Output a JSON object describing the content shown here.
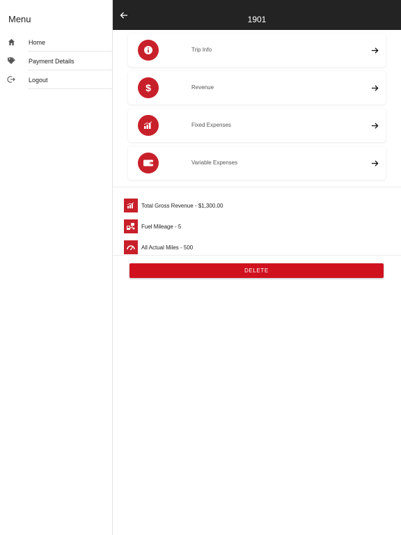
{
  "sidebar": {
    "title": "Menu",
    "items": [
      {
        "label": "Home",
        "icon": "home-icon"
      },
      {
        "label": "Payment Details",
        "icon": "tag-icon"
      },
      {
        "label": "Logout",
        "icon": "logout-icon"
      }
    ]
  },
  "header": {
    "title": "1901",
    "back_icon": "back-arrow-icon"
  },
  "cards": [
    {
      "label": "Trip Info",
      "icon": "info-icon"
    },
    {
      "label": "Revenue",
      "icon": "dollar-icon"
    },
    {
      "label": "Fixed Expenses",
      "icon": "chart-icon"
    },
    {
      "label": "Variable Expenses",
      "icon": "wallet-icon"
    }
  ],
  "summary": [
    {
      "text": "Total Gross Revenue - $1,300.00",
      "icon": "chart-icon"
    },
    {
      "text": "Fuel Mileage - 5",
      "icon": "fuel-icon"
    },
    {
      "text": "All Actual Miles - 500",
      "icon": "gauge-icon"
    }
  ],
  "delete_button": {
    "label": "DELETE"
  },
  "colors": {
    "accent": "#c8202a",
    "header_bg": "#232323",
    "delete_bg": "#d0121f"
  }
}
